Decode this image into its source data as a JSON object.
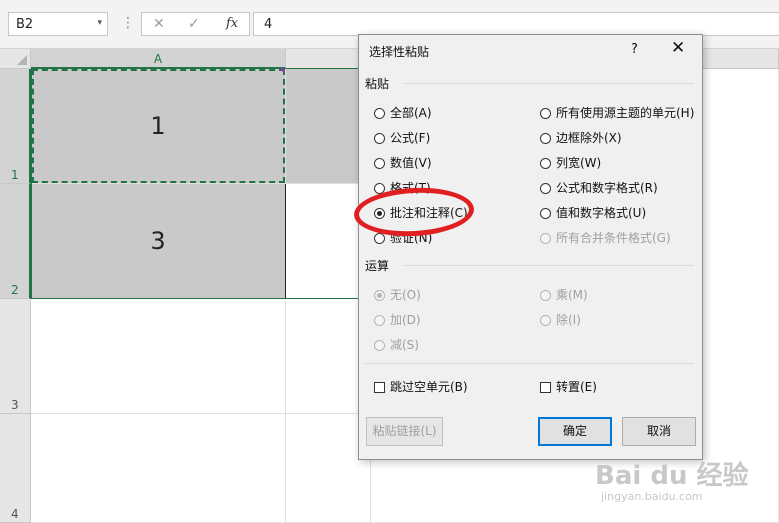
{
  "formula_bar": {
    "name_box": "B2",
    "name_dropdown": "▾",
    "dots": "⋮",
    "cancel_icon": "✕",
    "enter_icon": "✓",
    "fx_label": "fx",
    "value": "4"
  },
  "grid": {
    "columns": [
      "A"
    ],
    "rows": [
      "1",
      "2",
      "3",
      "4"
    ],
    "cells": {
      "A1": "1",
      "A2": "3"
    }
  },
  "dialog": {
    "title": "选择性粘贴",
    "help": "?",
    "close": "✕",
    "paste_section": "粘贴",
    "paste_options_left": [
      "全部(A)",
      "公式(F)",
      "数值(V)",
      "格式(T)",
      "批注和注释(C)",
      "验证(N)"
    ],
    "paste_options_right": [
      "所有使用源主题的单元(H)",
      "边框除外(X)",
      "列宽(W)",
      "公式和数字格式(R)",
      "值和数字格式(U)",
      "所有合并条件格式(G)"
    ],
    "operation_section": "运算",
    "operation_options_left": [
      "无(O)",
      "加(D)",
      "减(S)"
    ],
    "operation_options_right": [
      "乘(M)",
      "除(I)"
    ],
    "skip_blanks": "跳过空单元(B)",
    "transpose": "转置(E)",
    "paste_link_button": "粘贴链接(L)",
    "ok_button": "确定",
    "cancel_button": "取消"
  },
  "watermark": {
    "brand": "Bai du 经验",
    "url": "jingyan.baidu.com"
  }
}
